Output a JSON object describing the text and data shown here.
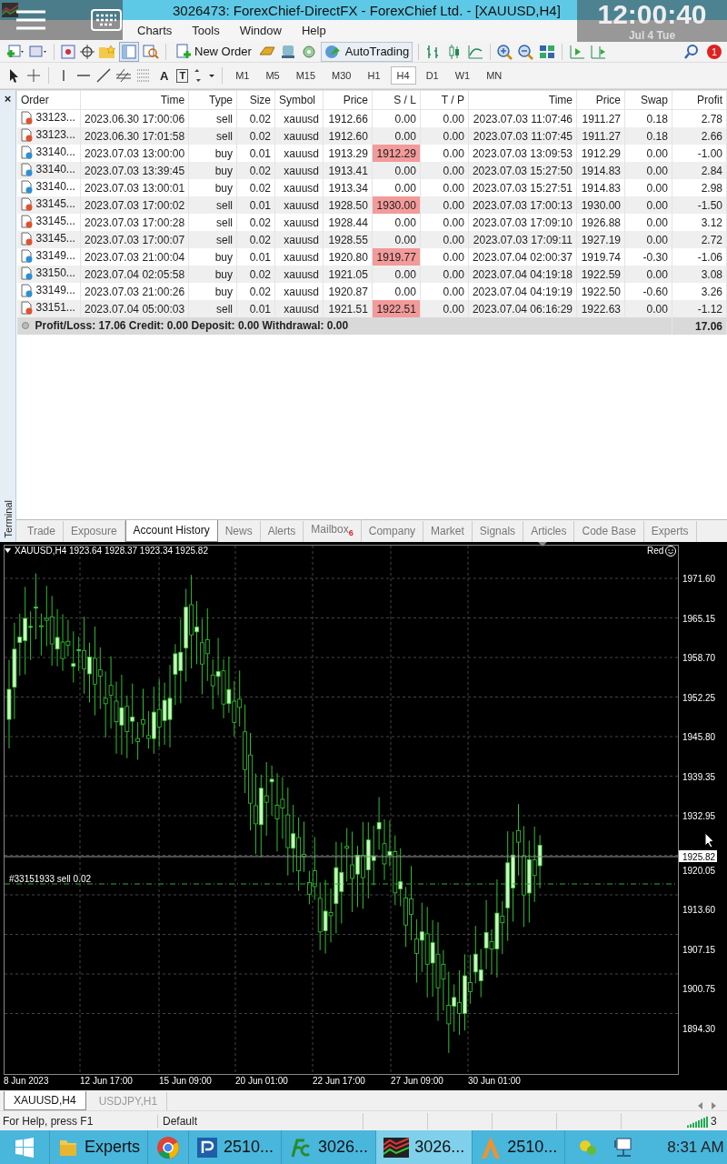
{
  "window": {
    "title": "3026473: ForexChief-DirectFX - ForexChief Ltd. - [XAUUSD,H4]"
  },
  "overlay": {
    "clock": "12:00:40",
    "date": "Jul 4 Tue"
  },
  "menu": [
    "Charts",
    "Tools",
    "Window",
    "Help"
  ],
  "toolbar": {
    "new_order": "New Order",
    "autotrading": "AutoTrading",
    "notifications": "1"
  },
  "drawing_tools": [
    "A",
    "T"
  ],
  "timeframes": [
    {
      "label": "M1",
      "selected": false
    },
    {
      "label": "M5",
      "selected": false
    },
    {
      "label": "M15",
      "selected": false
    },
    {
      "label": "M30",
      "selected": false
    },
    {
      "label": "H1",
      "selected": false
    },
    {
      "label": "H4",
      "selected": true
    },
    {
      "label": "D1",
      "selected": false
    },
    {
      "label": "W1",
      "selected": false
    },
    {
      "label": "MN",
      "selected": false
    }
  ],
  "terminal": {
    "label": "Terminal",
    "close": "×",
    "columns": [
      "Order",
      "Time",
      "Type",
      "Size",
      "Symbol",
      "Price",
      "S / L",
      "T / P",
      "Time",
      "Price",
      "Swap",
      "Profit"
    ],
    "rows": [
      {
        "order": "33123...",
        "time": "2023.06.30 17:00:06",
        "kind": "sell",
        "type": "sell",
        "size": "0.02",
        "symbol": "xauusd",
        "price": "1912.66",
        "sl": "0.00",
        "sl_hit": false,
        "tp": "0.00",
        "close_time": "2023.07.03 11:07:46",
        "close_price": "1911.27",
        "swap": "0.18",
        "profit": "2.78"
      },
      {
        "order": "33123...",
        "time": "2023.06.30 17:01:58",
        "kind": "sell",
        "type": "sell",
        "size": "0.02",
        "symbol": "xauusd",
        "price": "1912.60",
        "sl": "0.00",
        "sl_hit": false,
        "tp": "0.00",
        "close_time": "2023.07.03 11:07:45",
        "close_price": "1911.27",
        "swap": "0.18",
        "profit": "2.66"
      },
      {
        "order": "33140...",
        "time": "2023.07.03 13:00:00",
        "kind": "buy",
        "type": "buy",
        "size": "0.01",
        "symbol": "xauusd",
        "price": "1913.29",
        "sl": "1912.29",
        "sl_hit": true,
        "tp": "0.00",
        "close_time": "2023.07.03 13:09:53",
        "close_price": "1912.29",
        "swap": "0.00",
        "profit": "-1.00"
      },
      {
        "order": "33140...",
        "time": "2023.07.03 13:39:45",
        "kind": "buy",
        "type": "buy",
        "size": "0.02",
        "symbol": "xauusd",
        "price": "1913.41",
        "sl": "0.00",
        "sl_hit": false,
        "tp": "0.00",
        "close_time": "2023.07.03 15:27:50",
        "close_price": "1914.83",
        "swap": "0.00",
        "profit": "2.84"
      },
      {
        "order": "33140...",
        "time": "2023.07.03 13:00:01",
        "kind": "buy",
        "type": "buy",
        "size": "0.02",
        "symbol": "xauusd",
        "price": "1913.34",
        "sl": "0.00",
        "sl_hit": false,
        "tp": "0.00",
        "close_time": "2023.07.03 15:27:51",
        "close_price": "1914.83",
        "swap": "0.00",
        "profit": "2.98"
      },
      {
        "order": "33145...",
        "time": "2023.07.03 17:00:02",
        "kind": "sell",
        "type": "sell",
        "size": "0.01",
        "symbol": "xauusd",
        "price": "1928.50",
        "sl": "1930.00",
        "sl_hit": true,
        "tp": "0.00",
        "close_time": "2023.07.03 17:00:13",
        "close_price": "1930.00",
        "swap": "0.00",
        "profit": "-1.50"
      },
      {
        "order": "33145...",
        "time": "2023.07.03 17:00:28",
        "kind": "sell",
        "type": "sell",
        "size": "0.02",
        "symbol": "xauusd",
        "price": "1928.44",
        "sl": "0.00",
        "sl_hit": false,
        "tp": "0.00",
        "close_time": "2023.07.03 17:09:10",
        "close_price": "1926.88",
        "swap": "0.00",
        "profit": "3.12"
      },
      {
        "order": "33145...",
        "time": "2023.07.03 17:00:07",
        "kind": "sell",
        "type": "sell",
        "size": "0.02",
        "symbol": "xauusd",
        "price": "1928.55",
        "sl": "0.00",
        "sl_hit": false,
        "tp": "0.00",
        "close_time": "2023.07.03 17:09:11",
        "close_price": "1927.19",
        "swap": "0.00",
        "profit": "2.72"
      },
      {
        "order": "33149...",
        "time": "2023.07.03 21:00:04",
        "kind": "buy",
        "type": "buy",
        "size": "0.01",
        "symbol": "xauusd",
        "price": "1920.80",
        "sl": "1919.77",
        "sl_hit": true,
        "tp": "0.00",
        "close_time": "2023.07.04 02:00:37",
        "close_price": "1919.74",
        "swap": "-0.30",
        "profit": "-1.06"
      },
      {
        "order": "33150...",
        "time": "2023.07.04 02:05:58",
        "kind": "buy",
        "type": "buy",
        "size": "0.02",
        "symbol": "xauusd",
        "price": "1921.05",
        "sl": "0.00",
        "sl_hit": false,
        "tp": "0.00",
        "close_time": "2023.07.04 04:19:18",
        "close_price": "1922.59",
        "swap": "0.00",
        "profit": "3.08"
      },
      {
        "order": "33149...",
        "time": "2023.07.03 21:00:26",
        "kind": "buy",
        "type": "buy",
        "size": "0.02",
        "symbol": "xauusd",
        "price": "1920.87",
        "sl": "0.00",
        "sl_hit": false,
        "tp": "0.00",
        "close_time": "2023.07.04 04:19:19",
        "close_price": "1922.50",
        "swap": "-0.60",
        "profit": "3.26"
      },
      {
        "order": "33151...",
        "time": "2023.07.04 05:00:03",
        "kind": "sell",
        "type": "sell",
        "size": "0.01",
        "symbol": "xauusd",
        "price": "1921.51",
        "sl": "1922.51",
        "sl_hit": true,
        "tp": "0.00",
        "close_time": "2023.07.04 06:16:29",
        "close_price": "1922.63",
        "swap": "0.00",
        "profit": "-1.12"
      }
    ],
    "summary": "Profit/Loss: 17.06  Credit: 0.00  Deposit: 0.00  Withdrawal: 0.00",
    "summary_total": "17.06"
  },
  "terminal_tabs": [
    {
      "label": "Trade",
      "selected": false
    },
    {
      "label": "Exposure",
      "selected": false
    },
    {
      "label": "Account History",
      "selected": true
    },
    {
      "label": "News",
      "selected": false
    },
    {
      "label": "Alerts",
      "selected": false
    },
    {
      "label": "Mailbox",
      "badge": "6",
      "selected": false
    },
    {
      "label": "Company",
      "selected": false
    },
    {
      "label": "Market",
      "selected": false
    },
    {
      "label": "Signals",
      "selected": false
    },
    {
      "label": "Articles",
      "selected": false
    },
    {
      "label": "Code Base",
      "selected": false
    },
    {
      "label": "Experts",
      "selected": false
    }
  ],
  "chart": {
    "header": "XAUUSD,H4  1923.64 1928.37 1923.34 1925.82",
    "mode": "Red",
    "price_labels": [
      "1971.60",
      "1965.15",
      "1958.70",
      "1952.25",
      "1945.80",
      "1939.35",
      "1932.95",
      "1925.82",
      "1920.05",
      "1913.60",
      "1907.15",
      "1900.75",
      "1894.30"
    ],
    "time_labels": [
      "8 Jun 2023",
      "12 Jun 17:00",
      "15 Jun 09:00",
      "20 Jun 01:00",
      "22 Jun 17:00",
      "27 Jun 09:00",
      "30 Jun 01:00"
    ],
    "order_line": "#33151933 sell 0.02"
  },
  "chart_tabs": [
    {
      "label": "XAUUSD,H4",
      "selected": true
    },
    {
      "label": "USDJPY,H1",
      "selected": false
    }
  ],
  "status_bar": [
    "For Help, press F1",
    "Default"
  ],
  "status_tail": "3",
  "taskbar": {
    "items": [
      {
        "kind": "folder",
        "label": "Experts",
        "selected": false
      },
      {
        "kind": "browser",
        "selected": false
      },
      {
        "kind": "p-app",
        "label": "2510...",
        "selected": false
      },
      {
        "kind": "fc-app",
        "label": "3026...",
        "selected": false
      },
      {
        "kind": "chart-app",
        "label": "3026...",
        "selected": true
      },
      {
        "kind": "a-app",
        "label": "2510...",
        "selected": false
      }
    ],
    "time": "8:31 AM"
  }
}
